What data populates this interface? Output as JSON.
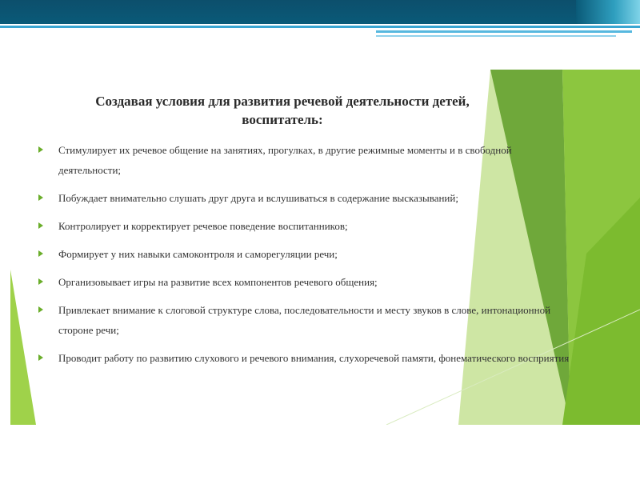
{
  "slide": {
    "title_line1": "Создавая условия для развития речевой деятельности детей,",
    "title_line2": "воспитатель:",
    "items": [
      {
        "text": "Стимулирует их речевое общение на занятиях, прогулках, в другие режимные моменты и в свободной деятельности;"
      },
      {
        "text": "Побуждает внимательно слушать друг друга и вслушиваться в содержание высказываний;"
      },
      {
        "text": "Контролирует и корректирует речевое поведение воспитанников;"
      },
      {
        "text": "Формирует у них навыки самоконтроля и саморегуляции речи;"
      },
      {
        "text": "Организовывает игры на развитие всех компонентов речевого общения;"
      },
      {
        "text": "Привлекает внимание к слоговой структуре слова, последовательности и месту звуков в слове, интонационной стороне речи;"
      },
      {
        "text": "Проводит работу по развитию слухового и речевого внимания, слухоречевой памяти, фонематического восприятия"
      }
    ]
  },
  "colors": {
    "header_bar": "#0c4f6c",
    "header_rule": "#3aa6d2",
    "bullet": "#6aae2a",
    "green_dark": "#6fa83a",
    "green_mid": "#8cc63f",
    "green_light": "#c9e39a"
  },
  "icons": {
    "bullet": "triangle-right-icon"
  }
}
